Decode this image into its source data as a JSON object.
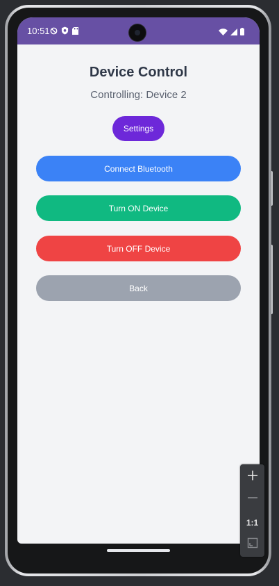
{
  "status_bar": {
    "time": "10:51",
    "background_color": "#6750a4",
    "left_icons": [
      "do-not-disturb-icon",
      "shield-icon",
      "sd-card-icon"
    ],
    "right_icons": [
      "wifi-icon",
      "signal-icon",
      "battery-icon"
    ]
  },
  "screen": {
    "title": "Device Control",
    "subtitle": "Controlling: Device 2",
    "background_color": "#f3f4f6"
  },
  "buttons": {
    "settings": {
      "label": "Settings",
      "color": "#6d28d9"
    },
    "connect": {
      "label": "Connect Bluetooth",
      "color": "#3b82f6"
    },
    "turn_on": {
      "label": "Turn ON Device",
      "color": "#10b981"
    },
    "turn_off": {
      "label": "Turn OFF Device",
      "color": "#ef4444"
    },
    "back": {
      "label": "Back",
      "color": "#9ca3af"
    }
  },
  "emulator_toolbar": {
    "zoom_in_icon": "plus-icon",
    "zoom_out_icon": "minus-icon",
    "actual_size_label": "1:1",
    "fit_screen_icon": "fit-screen-icon"
  }
}
